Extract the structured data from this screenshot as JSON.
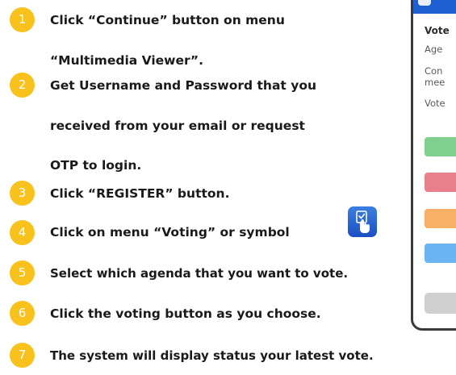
{
  "steps": [
    {
      "number": "1",
      "lines": [
        "Click “Continue” button on menu",
        "“Multimedia Viewer”."
      ]
    },
    {
      "number": "2",
      "lines": [
        "Get Username and Password that you",
        "received from your email or request",
        "OTP to login."
      ]
    },
    {
      "number": "3",
      "lines": [
        "Click “REGISTER” button."
      ]
    },
    {
      "number": "4",
      "lines": [
        "Click on menu “Voting” or symbol"
      ]
    },
    {
      "number": "5",
      "lines": [
        "Select which agenda that you want to vote."
      ]
    },
    {
      "number": "6",
      "lines": [
        "Click the voting button as you choose."
      ]
    },
    {
      "number": "7",
      "lines": [
        "The system will display status your latest vote."
      ]
    }
  ],
  "phone": {
    "title": "Vote",
    "line1": "Age",
    "line2a": "Con",
    "line2b": "mee",
    "line3": "Vote",
    "buttons": [
      {
        "color": "#7fcf8f"
      },
      {
        "color": "#e8808c"
      },
      {
        "color": "#f7b066"
      },
      {
        "color": "#6bb5f3"
      }
    ]
  },
  "icons": {
    "vote": "hand-tap-icon",
    "phone_logo": "app-logo-icon"
  },
  "colors": {
    "badge": "#f9c11b",
    "phone_header": "#1e5fd1",
    "icon_bg": "#1b4fc4"
  }
}
